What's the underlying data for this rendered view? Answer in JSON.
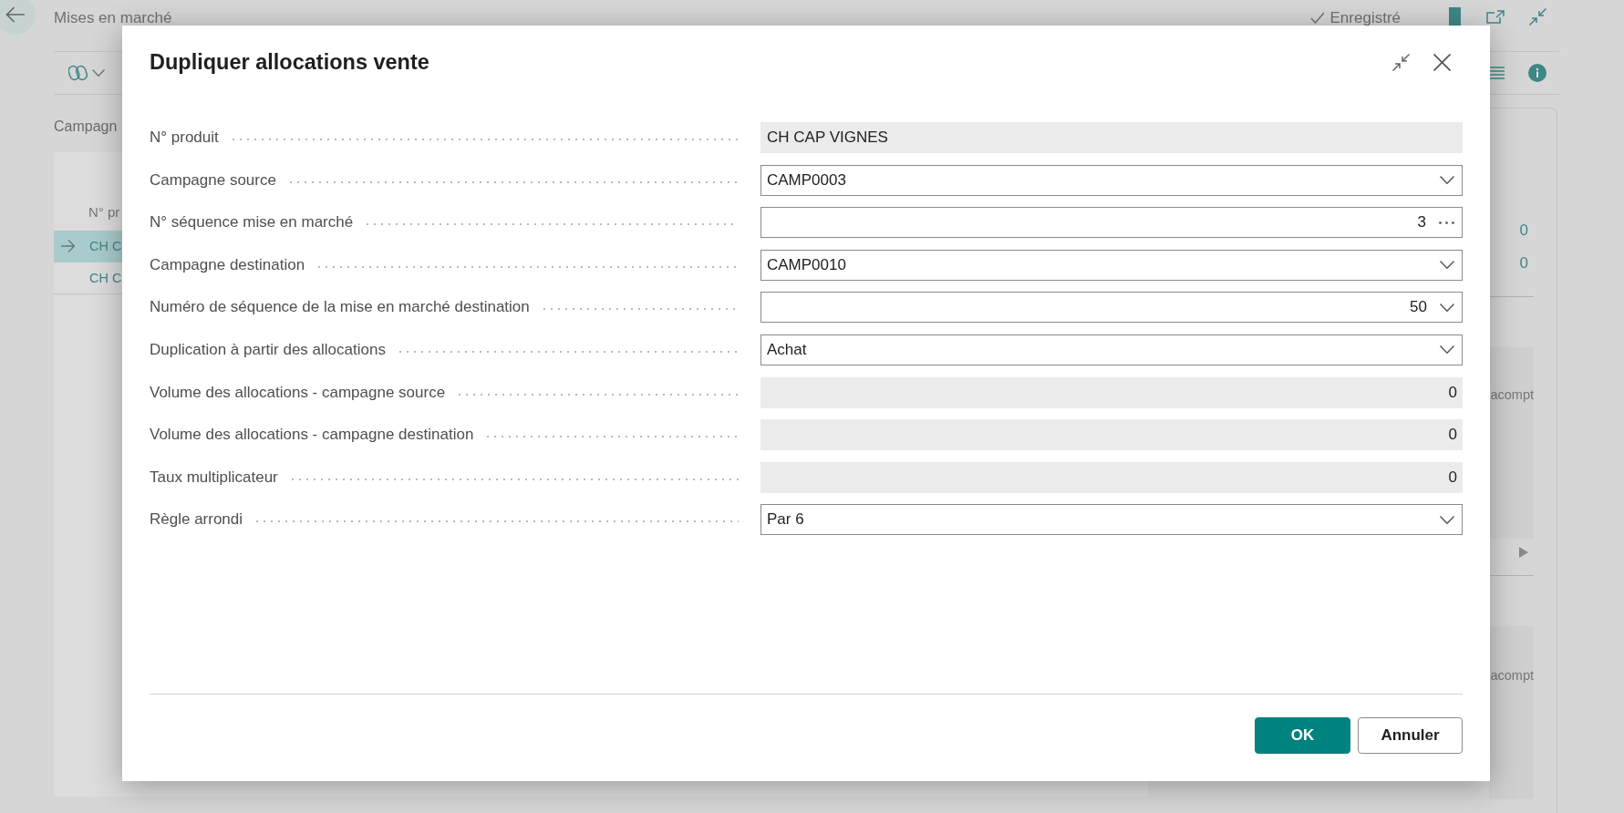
{
  "page": {
    "title": "Mises en marché",
    "status": "Enregistré",
    "section_title": "Campagn",
    "table": {
      "column_1": "N° pr",
      "rows": [
        {
          "column_1": "CH C",
          "selected": true
        },
        {
          "column_1": "CH C",
          "selected": false
        }
      ]
    },
    "side_panel": {
      "values": [
        "0",
        "0"
      ],
      "captions": [
        "acompt",
        "acompt"
      ]
    }
  },
  "dialog": {
    "title": "Dupliquer allocations vente",
    "fields": [
      {
        "label": "N° produit",
        "value": "CH CAP VIGNES",
        "kind": "readonly",
        "numeric": false
      },
      {
        "label": "Campagne source",
        "value": "CAMP0003",
        "kind": "dropdown",
        "numeric": false
      },
      {
        "label": "N° séquence mise en marché",
        "value": "3",
        "kind": "lookup",
        "numeric": true
      },
      {
        "label": "Campagne destination",
        "value": "CAMP0010",
        "kind": "dropdown",
        "numeric": false
      },
      {
        "label": "Numéro de séquence de la mise en marché destination",
        "value": "50",
        "kind": "dropdown",
        "numeric": true
      },
      {
        "label": "Duplication à partir des allocations",
        "value": "Achat",
        "kind": "dropdown",
        "numeric": false
      },
      {
        "label": "Volume des allocations - campagne source",
        "value": "0",
        "kind": "readonly",
        "numeric": true
      },
      {
        "label": "Volume des allocations - campagne destination",
        "value": "0",
        "kind": "readonly",
        "numeric": true
      },
      {
        "label": "Taux multiplicateur",
        "value": "0",
        "kind": "readonly",
        "numeric": true
      },
      {
        "label": "Règle arrondi",
        "value": "Par 6",
        "kind": "dropdown",
        "numeric": false
      }
    ],
    "buttons": [
      {
        "label": "OK",
        "kind": "primary"
      },
      {
        "label": "Annuler",
        "kind": "secondary"
      }
    ]
  }
}
